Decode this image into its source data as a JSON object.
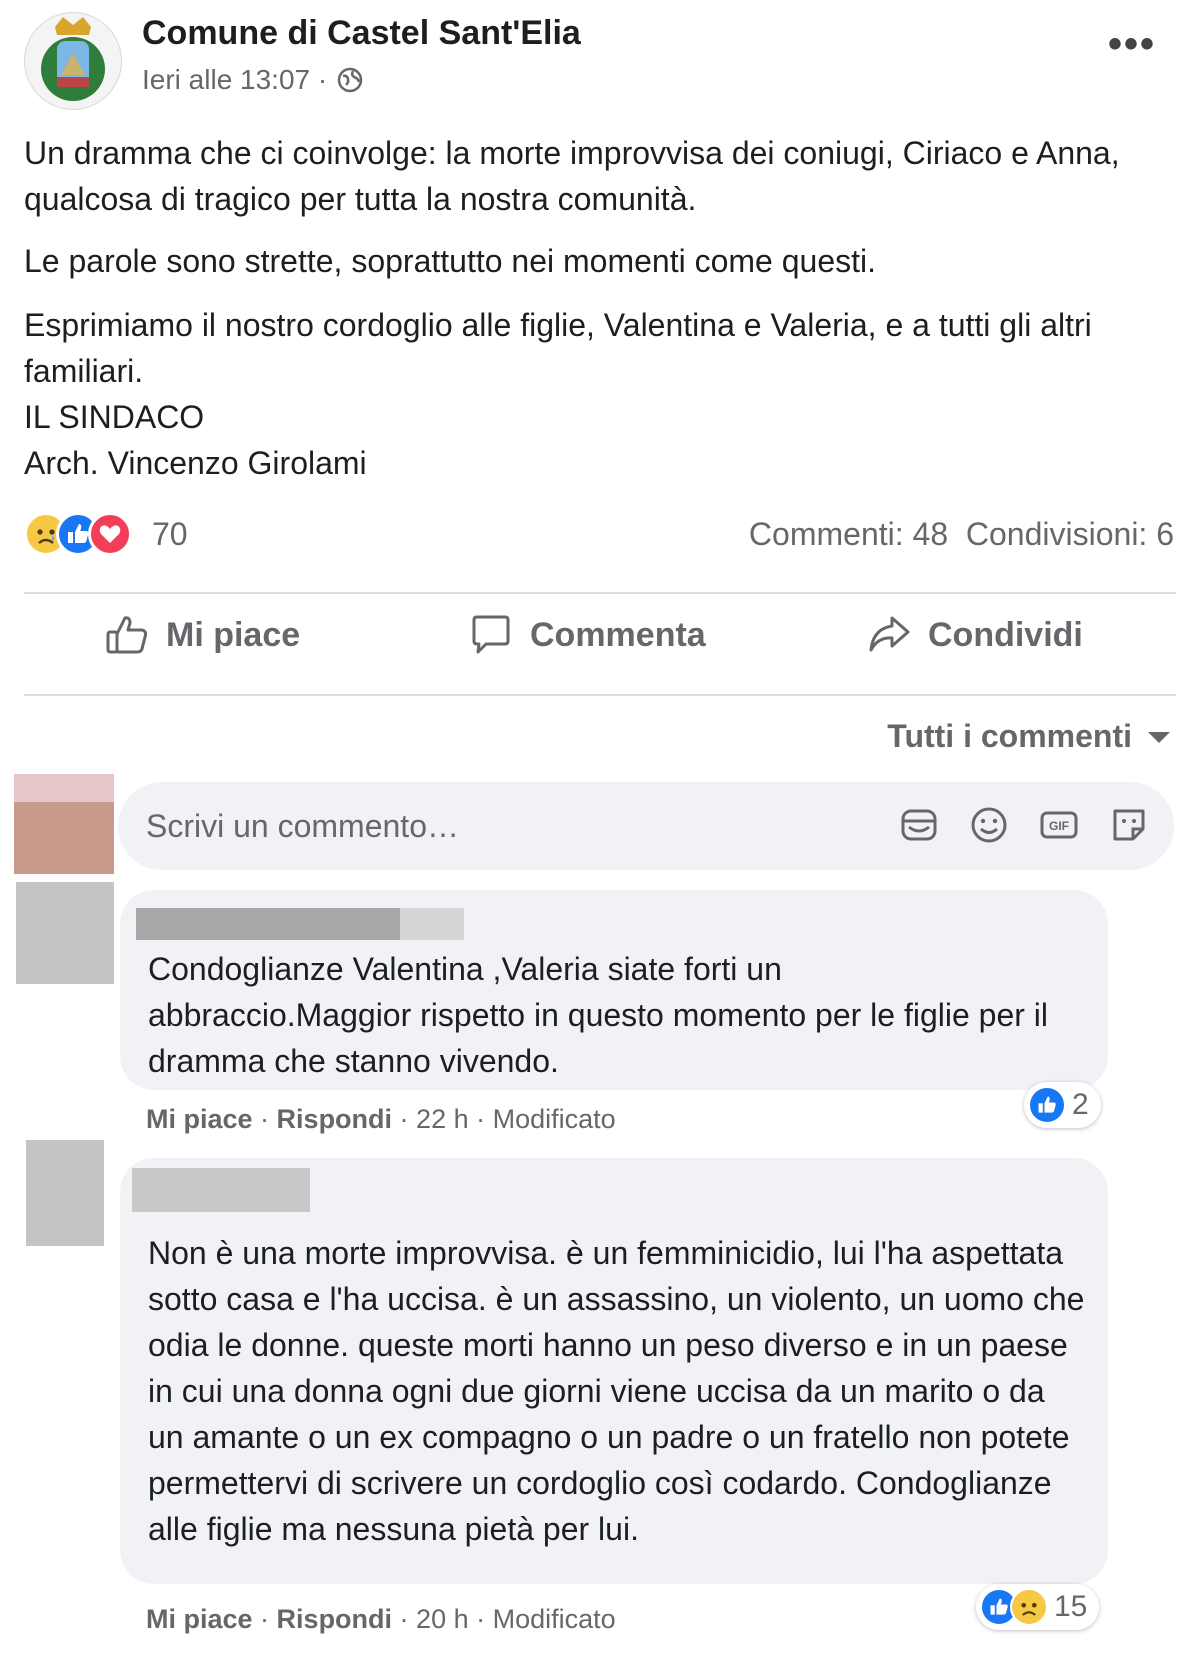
{
  "post": {
    "page_name": "Comune di Castel Sant'Elia",
    "timestamp": "Ieri alle 13:07 ·",
    "audience_icon": "globe-icon",
    "more_icon": "•••",
    "text_p1": "Un dramma che ci coinvolge: la morte improvvisa dei coniugi,  Ciriaco e Anna, qualcosa di tragico per tutta la nostra comunità.",
    "text_p2": "Le parole sono strette, soprattutto nei momenti come questi.",
    "text_p3_line1": "Esprimiamo il nostro cordoglio alle figlie, Valentina e Valeria, e a tutti gli altri familiari.",
    "text_p3_line2": "IL SINDACO",
    "text_p3_line3": "Arch. Vincenzo Girolami"
  },
  "reactions": {
    "icons": [
      "sad",
      "like",
      "love"
    ],
    "count": "70",
    "comments": "Commenti: 48",
    "shares": "Condivisioni: 6"
  },
  "actions": {
    "like": "Mi piace",
    "comment": "Commenta",
    "share": "Condividi"
  },
  "comments_section": {
    "sort_label": "Tutti i commenti",
    "compose_placeholder": "Scrivi un commento…",
    "compose_icons": [
      "camera-sticker-icon",
      "emoji-icon",
      "gif-icon",
      "sticker-icon"
    ],
    "items": [
      {
        "text": "Condoglianze Valentina ,Valeria siate forti un abbraccio.Maggior rispetto in questo momento per le figlie per il dramma che stanno vivendo.",
        "like": "Mi piace",
        "reply": "Rispondi",
        "time": "22 h",
        "edited": "Modificato",
        "reaction_count": "2"
      },
      {
        "text": "Non è una morte improvvisa. è un femminicidio, lui l'ha aspettata sotto casa e l'ha uccisa. è un assassino, un violento, un uomo che odia le donne. queste morti hanno un peso diverso e in un paese in cui una donna ogni due giorni viene uccisa da un marito o da un amante o un ex compagno o un padre o un fratello non potete permettervi di scrivere un cordoglio così codardo. Condoglianze alle figlie ma nessuna pietà per lui.",
        "like": "Mi piace",
        "reply": "Rispondi",
        "time": "20 h",
        "edited": "Modificato",
        "reaction_count": "15"
      }
    ]
  },
  "colors": {
    "like_blue": "#1877f2",
    "love_red": "#f33e58",
    "sad_yellow": "#f7c843",
    "secondary_text": "#65676b",
    "bubble_bg": "#f0f2f5"
  }
}
